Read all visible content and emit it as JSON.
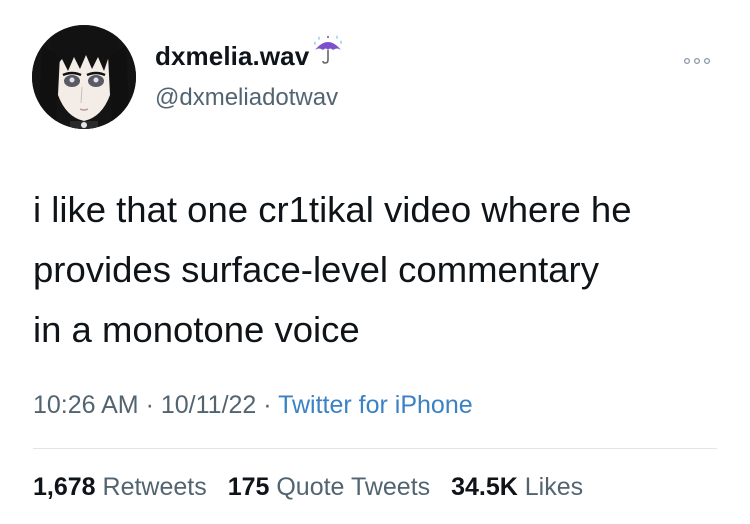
{
  "author": {
    "display_name": "dxmelia.wav",
    "handle": "@dxmeliadotwav",
    "name_emoji": "umbrella-with-rain-icon"
  },
  "tweet": {
    "line1": "i like that one cr1tikal video where he",
    "line2": "provides surface-level commentary",
    "line3": "in a monotone voice"
  },
  "meta": {
    "time": "10:26 AM",
    "sep1": " · ",
    "date": "10/11/22",
    "sep2": " · ",
    "source": "Twitter for iPhone"
  },
  "stats": {
    "retweets_count": "1,678",
    "retweets_label": " Retweets",
    "quotes_count": "175",
    "quotes_label": " Quote Tweets",
    "likes_count": "34.5K",
    "likes_label": " Likes"
  },
  "colors": {
    "text": "#0f1419",
    "secondary": "#536471",
    "link": "#3b82c4",
    "divider": "#e1e4e8"
  }
}
